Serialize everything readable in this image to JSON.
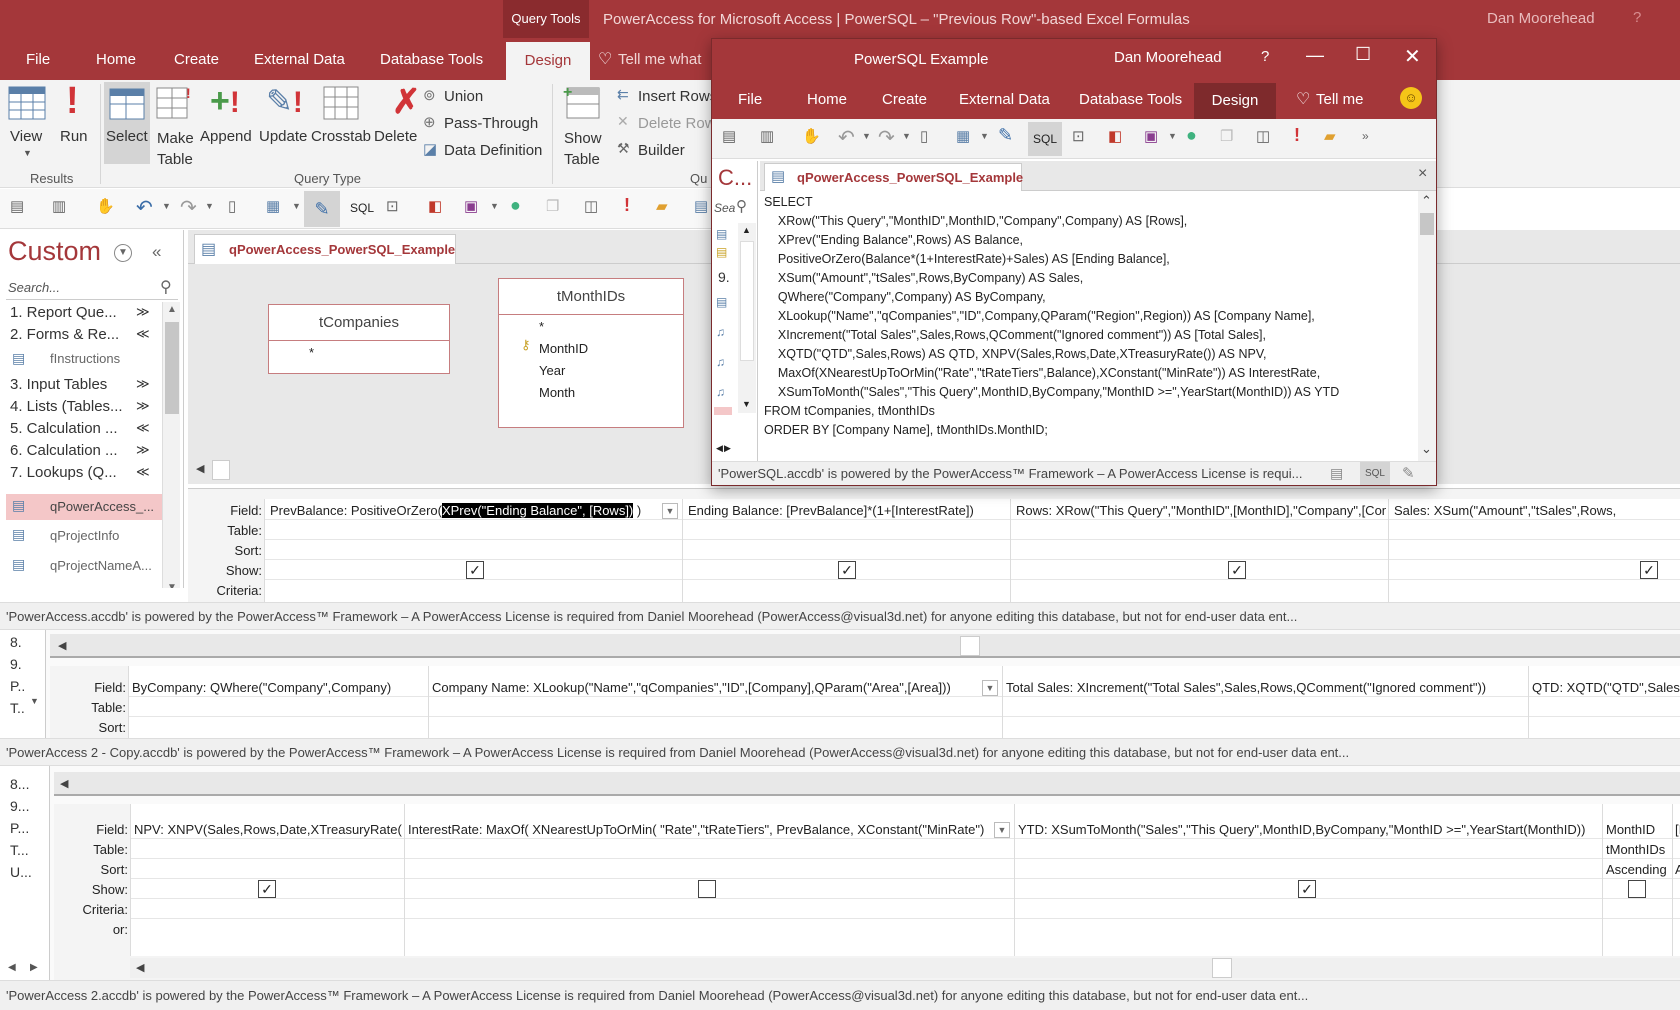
{
  "titlebar": {
    "query_tools": "Query Tools",
    "title": "PowerAccess for Microsoft Access   |   PowerSQL  –  \"Previous Row\"-based Excel Formulas",
    "user": "Dan Moorehead",
    "help": "?"
  },
  "ribbon_tabs": [
    "File",
    "Home",
    "Create",
    "External Data",
    "Database Tools",
    "Design"
  ],
  "tell_me": "Tell me what",
  "ribbon": {
    "results_group": "Results",
    "query_type_group": "Query Type",
    "qu_group": "Qu",
    "view": "View",
    "run": "Run",
    "select": "Select",
    "make_table": "Make\nTable",
    "append": "Append",
    "update": "Update",
    "crosstab": "Crosstab",
    "delete": "Delete",
    "union": "Union",
    "pass_through": "Pass-Through",
    "data_definition": "Data Definition",
    "show_table": "Show\nTable",
    "insert_rows": "Insert Rows",
    "delete_rows": "Delete Rows",
    "builder": "Builder"
  },
  "qat_sql": "SQL",
  "nav": {
    "title": "Custom",
    "collapse": "«",
    "search_placeholder": "Search...",
    "groups": [
      {
        "label": "1. Report Que...",
        "arrow": "≫"
      },
      {
        "label": "2. Forms & Re...",
        "arrow": "≪"
      },
      {
        "label": "fInstructions",
        "arrow": ""
      },
      {
        "label": "3. Input Tables",
        "arrow": "≫"
      },
      {
        "label": "4. Lists (Tables...",
        "arrow": "≫"
      },
      {
        "label": "5. Calculation ...",
        "arrow": "≪"
      },
      {
        "label": "6. Calculation ...",
        "arrow": "≫"
      },
      {
        "label": "7. Lookups (Q...",
        "arrow": "≪"
      },
      {
        "label": "qPowerAccess_...",
        "arrow": ""
      },
      {
        "label": "qProjectInfo",
        "arrow": ""
      },
      {
        "label": "qProjectNameA...",
        "arrow": ""
      }
    ]
  },
  "doc_tab": "qPowerAccess_PowerSQL_Example",
  "tables": {
    "t1": {
      "name": "tCompanies",
      "fields": [
        "*"
      ]
    },
    "t2": {
      "name": "tMonthIDs",
      "fields": [
        "*",
        "MonthID",
        "Year",
        "Month"
      ]
    }
  },
  "grid1": {
    "row_labels": [
      "Field:",
      "Table:",
      "Sort:",
      "Show:",
      "Criteria:"
    ],
    "col1_pre": "PrevBalance: PositiveOrZero(",
    "col1_sel": "XPrev(\"Ending Balance\", [Rows])",
    "col1_post": " )",
    "col2": "Ending Balance: [PrevBalance]*(1+[InterestRate])",
    "col3": "Rows: XRow(\"This Query\",\"MonthID\",[MonthID],\"Company\",[Company])",
    "col4": "Sales: XSum(\"Amount\",\"tSales\",Rows,"
  },
  "status1": "'PowerAccess.accdb' is powered by the PowerAccess™ Framework  –  A PowerAccess License is required from Daniel Moorehead (PowerAccess@visual3d.net) for anyone editing this database, but not for end-user data ent...",
  "grid2": {
    "nav_items": [
      "8.",
      "9.",
      "P..",
      "T.."
    ],
    "row_labels": [
      "Field:",
      "Table:",
      "Sort:"
    ],
    "col1": "ByCompany: QWhere(\"Company\",Company)",
    "col2": "Company Name: XLookup(\"Name\",\"qCompanies\",\"ID\",[Company],QParam(\"Area\",[Area]))",
    "col3": "Total Sales: XIncrement(\"Total Sales\",Sales,Rows,QComment(\"Ignored comment\"))",
    "col4": "QTD: XQTD(\"QTD\",Sales,R"
  },
  "status2": "'PowerAccess 2 - Copy.accdb' is powered by the PowerAccess™ Framework  –  A PowerAccess License is required from Daniel Moorehead (PowerAccess@visual3d.net) for anyone editing this database, but not for end-user data ent...",
  "grid3": {
    "nav_items": [
      "8...",
      "9...",
      "P...",
      "T...",
      "U..."
    ],
    "row_labels": [
      "Field:",
      "Table:",
      "Sort:",
      "Show:",
      "Criteria:",
      "or:"
    ],
    "col1": "NPV: XNPV(Sales,Rows,Date,XTreasuryRate())",
    "col2": "InterestRate: MaxOf( XNearestUpToOrMin( \"Rate\",\"tRateTiers\", PrevBalance, XConstant(\"MinRate\")",
    "col3": "YTD: XSumToMonth(\"Sales\",\"This Query\",MonthID,ByCompany,\"MonthID >=\",YearStart(MonthID))",
    "col4_field": "MonthID",
    "col4_table": "tMonthIDs",
    "col4_sort": "Ascending",
    "col5_field": "[I",
    "col5_table": "",
    "col5_sort": "A"
  },
  "status3": "'PowerAccess 2.accdb' is powered by the PowerAccess™ Framework  –  A PowerAccess License is required from Daniel Moorehead (PowerAccess@visual3d.net) for anyone editing this database, but not for end-user data ent...",
  "popup": {
    "title": "PowerSQL Example",
    "user": "Dan Moorehead",
    "help": "?",
    "tabs": [
      "File",
      "Home",
      "Create",
      "External Data",
      "Database Tools",
      "Design"
    ],
    "tell_me": "Tell me",
    "sql_btn": "SQL",
    "nav_title": "C...",
    "nav_search": "Sea",
    "nav_item": "9.",
    "doc_tab": "qPowerAccess_PowerSQL_Example",
    "close": "×",
    "sql_lines": [
      "SELECT",
      "    XRow(\"This Query\",\"MonthID\",MonthID,\"Company\",Company) AS [Rows],",
      "    XPrev(\"Ending Balance\",Rows) AS Balance,",
      "    PositiveOrZero(Balance*(1+InterestRate)+Sales) AS [Ending Balance],",
      "    XSum(\"Amount\",\"tSales\",Rows,ByCompany) AS Sales,",
      "    QWhere(\"Company\",Company) AS ByCompany,",
      "    XLookup(\"Name\",\"qCompanies\",\"ID\",Company,QParam(\"Region\",Region)) AS [Company Name],",
      "    XIncrement(\"Total Sales\",Sales,Rows,QComment(\"Ignored comment\")) AS [Total Sales],",
      "    XQTD(\"QTD\",Sales,Rows) AS QTD, XNPV(Sales,Rows,Date,XTreasuryRate()) AS NPV,",
      "    MaxOf(XNearestUpToOrMin(\"Rate\",\"tRateTiers\",Balance),XConstant(\"MinRate\")) AS InterestRate,",
      "    XSumToMonth(\"Sales\",\"This Query\",MonthID,ByCompany,\"MonthID >=\",YearStart(MonthID)) AS YTD",
      "FROM tCompanies, tMonthIDs",
      "ORDER BY [Company Name], tMonthIDs.MonthID;"
    ],
    "status": "'PowerSQL.accdb' is powered by the PowerAccess™ Framework  –  A PowerAccess License is requi...",
    "status_sql": "SQL"
  },
  "colors": {
    "accent": "#a4373a",
    "ribbon": "#f3f3f3",
    "select_hl": "#f4c7c8"
  }
}
